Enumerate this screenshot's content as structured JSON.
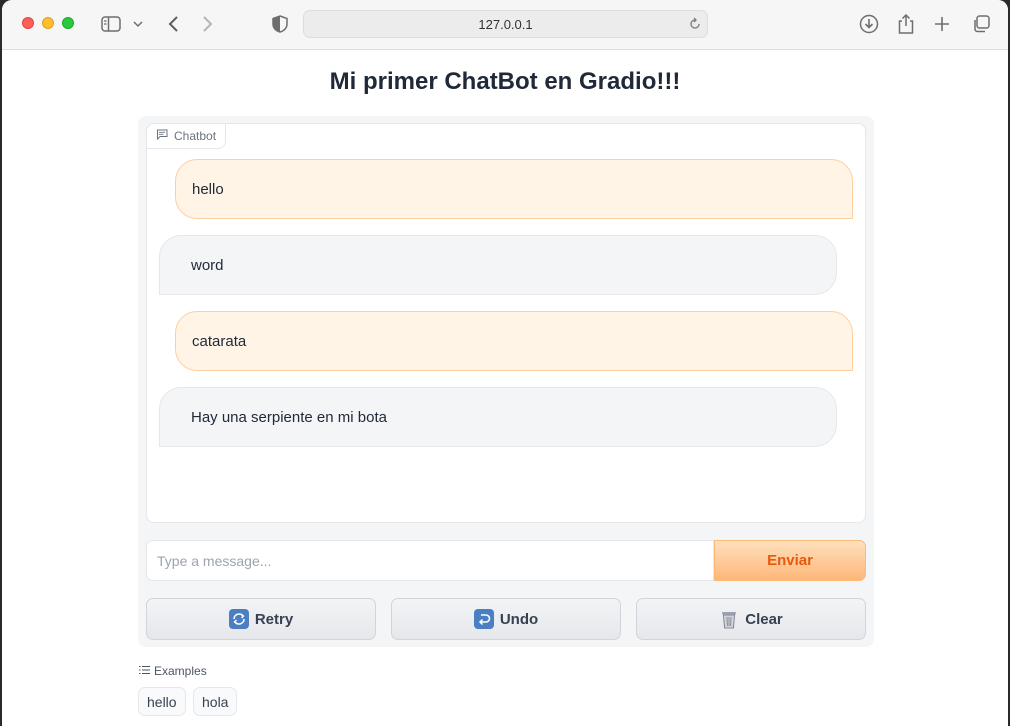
{
  "browser": {
    "url": "127.0.0.1"
  },
  "page": {
    "title": "Mi primer ChatBot en Gradio!!!"
  },
  "chatbot": {
    "label": "Chatbot",
    "messages": [
      {
        "role": "user",
        "text": "hello"
      },
      {
        "role": "bot",
        "text": "word"
      },
      {
        "role": "user",
        "text": "catarata"
      },
      {
        "role": "bot",
        "text": "Hay una serpiente en mi bota"
      }
    ]
  },
  "input": {
    "placeholder": "Type a message...",
    "value": "",
    "send_label": "Enviar"
  },
  "actions": {
    "retry_label": "Retry",
    "undo_label": "Undo",
    "clear_label": "Clear"
  },
  "examples": {
    "label": "Examples",
    "items": [
      "hello",
      "hola"
    ]
  },
  "colors": {
    "accent": "#ea580c",
    "user_bubble": "#fff4e6",
    "bot_bubble": "#f4f5f7"
  }
}
